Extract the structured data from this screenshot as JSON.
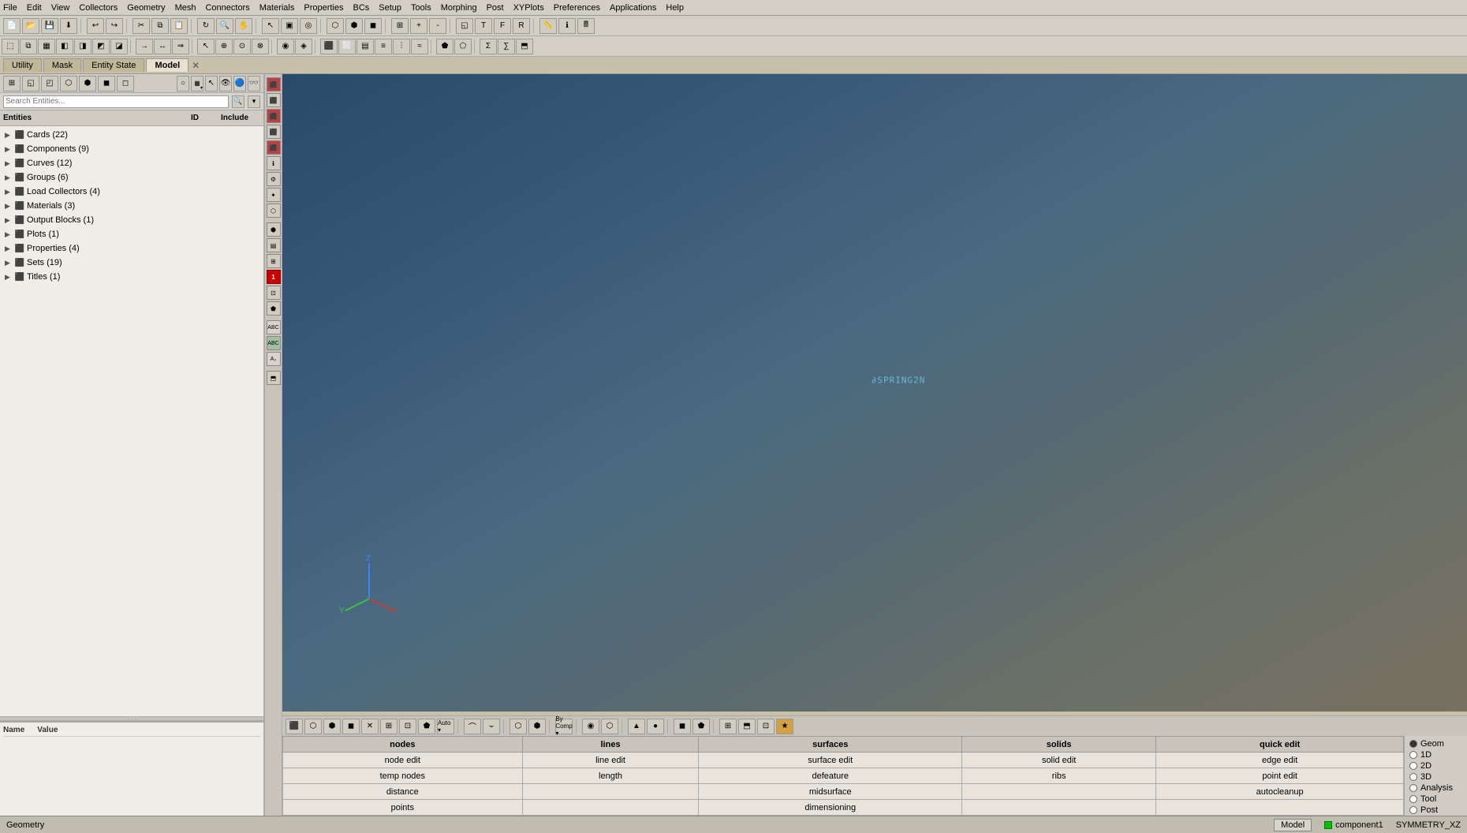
{
  "menubar": {
    "items": [
      "File",
      "Edit",
      "View",
      "Collectors",
      "Geometry",
      "Mesh",
      "Connectors",
      "Materials",
      "Properties",
      "BCs",
      "Setup",
      "Tools",
      "Morphing",
      "Post",
      "XYPlots",
      "Preferences",
      "Applications",
      "Help"
    ]
  },
  "tabs": {
    "items": [
      "Utility",
      "Mask",
      "Entity State",
      "Model"
    ],
    "active": "Model"
  },
  "entity_panel": {
    "search_placeholder": "Search Entities...",
    "columns": [
      "Entities",
      "ID",
      "Include"
    ],
    "tree_items": [
      {
        "label": "Cards (22)",
        "indent": 0,
        "expanded": false
      },
      {
        "label": "Components (9)",
        "indent": 0,
        "expanded": false
      },
      {
        "label": "Curves (12)",
        "indent": 0,
        "expanded": false
      },
      {
        "label": "Groups (6)",
        "indent": 0,
        "expanded": false
      },
      {
        "label": "Load Collectors (4)",
        "indent": 0,
        "expanded": false
      },
      {
        "label": "Materials (3)",
        "indent": 0,
        "expanded": false
      },
      {
        "label": "Output Blocks (1)",
        "indent": 0,
        "expanded": false
      },
      {
        "label": "Plots (1)",
        "indent": 0,
        "expanded": false
      },
      {
        "label": "Properties (4)",
        "indent": 0,
        "expanded": false
      },
      {
        "label": "Sets (19)",
        "indent": 0,
        "expanded": false
      },
      {
        "label": "Titles (1)",
        "indent": 0,
        "expanded": false
      }
    ]
  },
  "name_value": {
    "name_label": "Name",
    "value_label": "Value"
  },
  "viewport": {
    "label": "∂SPRING2N"
  },
  "bottom_nav": {
    "nodes_label": "nodes",
    "lines_label": "lines",
    "surfaces_label": "surfaces",
    "solids_label": "solids",
    "quick_edit_label": "quick edit",
    "rows": [
      [
        "node edit",
        "line edit",
        "surface edit",
        "solid edit",
        "edge edit"
      ],
      [
        "temp nodes",
        "length",
        "defeature",
        "ribs",
        "point edit"
      ],
      [
        "distance",
        "",
        "midsurface",
        "",
        "autocleanup"
      ],
      [
        "points",
        "",
        "dimensioning",
        "",
        ""
      ]
    ]
  },
  "radio_options": [
    "Geom",
    "1D",
    "2D",
    "3D",
    "Analysis",
    "Tool",
    "Post"
  ],
  "statusbar": {
    "left_label": "Geometry",
    "model_label": "Model",
    "component_label": "component1",
    "symmetry_label": "SYMMETRY_XZ"
  }
}
